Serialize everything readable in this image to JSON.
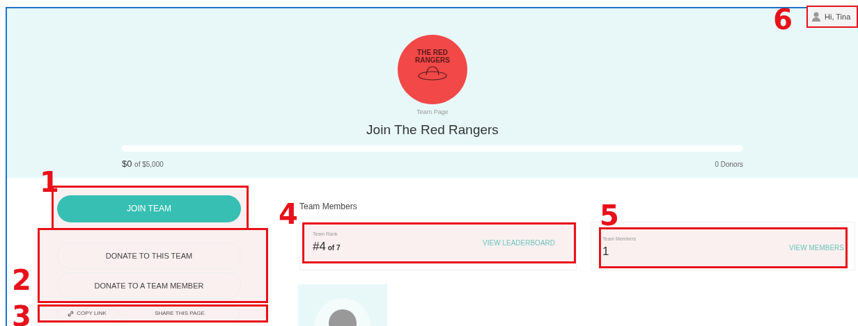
{
  "user_menu": {
    "greeting": "Hi, Tina",
    "callout": "6"
  },
  "hero": {
    "logo_text": "THE RED RANGERS",
    "eyebrow": "Team Page",
    "title": "Join The Red Rangers",
    "raised": "$0",
    "goal": "of $5,000",
    "donors": "0 Donors"
  },
  "join": {
    "label": "JOIN TEAM",
    "callout": "1"
  },
  "donate": {
    "callout": "2",
    "buttons": [
      "DONATE TO THIS TEAM",
      "DONATE TO A TEAM MEMBER"
    ]
  },
  "share": {
    "callout": "3",
    "copy_link": "COPY LINK",
    "share_page": "SHARE THIS PAGE"
  },
  "members_section": {
    "heading": "Team Members",
    "heading_callout": "4",
    "stats": [
      {
        "label": "Team Rank",
        "value": "#4",
        "suffix": "of 7",
        "link": "VIEW LEADERBOARD"
      },
      {
        "label": "Team Members",
        "value": "1",
        "link": "VIEW MEMBERS",
        "callout": "5"
      }
    ]
  }
}
